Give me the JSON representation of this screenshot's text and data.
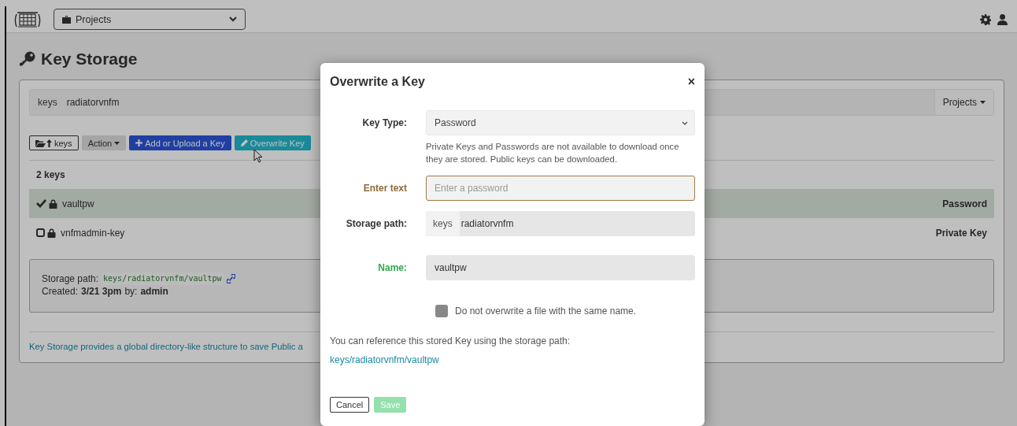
{
  "navbar": {
    "project_select": "Projects"
  },
  "page": {
    "title": "Key Storage",
    "breadcrumb": {
      "root": "keys",
      "path": "radiatorvnfm",
      "menu": "Projects"
    },
    "toolbar": [
      {
        "kind": "up",
        "label": "keys"
      },
      {
        "kind": "dropdown",
        "label": "Action"
      },
      {
        "kind": "add",
        "label": "Add or Upload a Key"
      },
      {
        "kind": "overwrite",
        "label": "Overwrite Key"
      }
    ],
    "count": "2 keys",
    "keys": [
      {
        "name": "vaultpw",
        "type": "Password",
        "selected": true
      },
      {
        "name": "vnfmadmin-key",
        "type": "Private Key",
        "selected": false
      }
    ],
    "details": {
      "path_label": "Storage path:",
      "path": "keys/radiatorvnfm/vaultpw",
      "created_label": "Created:",
      "created": "3/21 3pm",
      "by_label": "by:",
      "by": "admin"
    },
    "footer_text": "Key Storage provides a global directory-like structure to save Public a"
  },
  "modal": {
    "title": "Overwrite a Key",
    "close": "×",
    "fields": [
      {
        "kind": "select",
        "label": "Key Type:",
        "value": "Password",
        "help": "Private Keys and Passwords are not available to download once they are stored. Public keys can be downloaded."
      },
      {
        "kind": "text",
        "label": "Enter text",
        "placeholder": "Enter a password",
        "warning": true,
        "success": false
      },
      {
        "kind": "path",
        "label": "Storage path:",
        "prefix": "keys",
        "value": "radiatorvnfm"
      },
      {
        "kind": "text",
        "label": "Name:",
        "value": "vaultpw",
        "warning": false,
        "success": true
      }
    ],
    "checkbox": {
      "label": "Do not overwrite a file with the same name.",
      "checked": false
    },
    "reference_text": "You can reference this stored Key using the storage path:",
    "reference_link": "keys/radiatorvnfm/vaultpw",
    "buttons": [
      {
        "kind": "cancel",
        "label": "Cancel",
        "disabled": false
      },
      {
        "kind": "save",
        "label": "Save",
        "disabled": true
      }
    ]
  }
}
